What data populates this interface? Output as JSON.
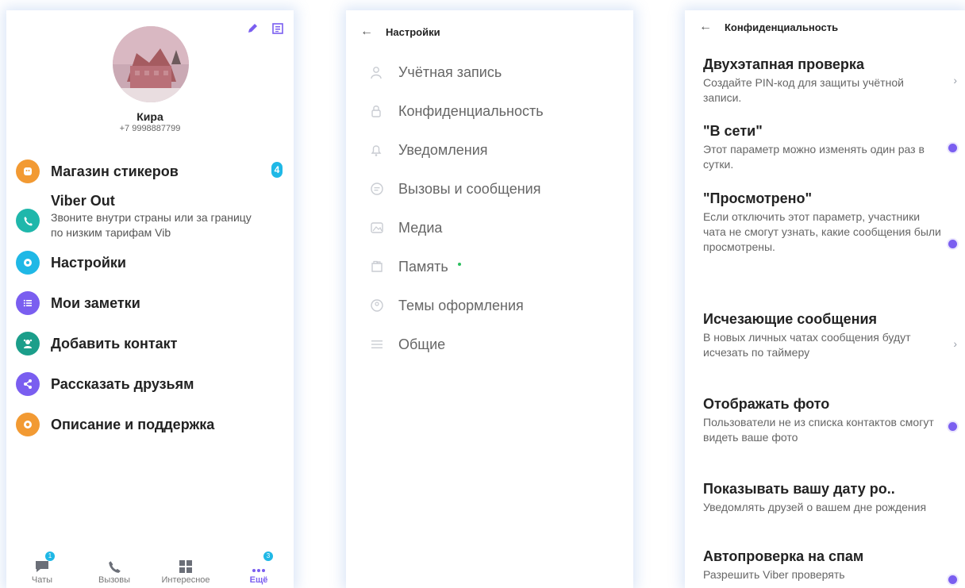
{
  "more_screen": {
    "profile": {
      "name": "Кира",
      "phone": "+7 9998887799"
    },
    "menu": [
      {
        "label": "Магазин стикеров",
        "badge": "4",
        "icon": "sticker-icon",
        "color": "#f29a33"
      },
      {
        "label": "Настройки",
        "icon": "gear-icon",
        "color": "#1fb8e6"
      },
      {
        "label": "Мои заметки",
        "icon": "notes-icon",
        "color": "#7a5ef0"
      },
      {
        "label": "Добавить контакт",
        "icon": "add-contact-icon",
        "color": "#1b9e8a"
      },
      {
        "label": "Рассказать друзьям",
        "icon": "share-icon",
        "color": "#7a5ef0"
      },
      {
        "label": "Описание и поддержка",
        "icon": "info-icon",
        "color": "#f29a33"
      }
    ],
    "viber_out": {
      "label": "Viber Out",
      "description": "Звоните внутри страны или за границу по низким тарифам Vib",
      "color": "#1fb7ab"
    },
    "bottom_nav": [
      {
        "label": "Чаты",
        "badge": "1"
      },
      {
        "label": "Вызовы"
      },
      {
        "label": "Интересное"
      },
      {
        "label": "Ещё",
        "badge": "3",
        "active": true
      }
    ],
    "accent_color": "#7a5ef0"
  },
  "settings_screen": {
    "back_icon": "arrow-left-icon",
    "title": "Настройки",
    "items": [
      {
        "label": "Учётная запись",
        "icon": "user-icon"
      },
      {
        "label": "Конфиденциальность",
        "icon": "lock-icon"
      },
      {
        "label": "Уведомления",
        "icon": "bell-icon"
      },
      {
        "label": "Вызовы и сообщения",
        "icon": "chat-icon"
      },
      {
        "label": "Медиа",
        "icon": "media-icon"
      },
      {
        "label": "Память",
        "icon": "storage-icon",
        "dot": true
      },
      {
        "label": "Темы оформления",
        "icon": "palette-icon"
      },
      {
        "label": "Общие",
        "icon": "menu-icon"
      }
    ]
  },
  "privacy_screen": {
    "title": "Конфиденциальность",
    "items": [
      {
        "title": "Двухэтапная проверка",
        "description": "Создайте PIN-код для защиты учётной записи.",
        "control": "chevron"
      },
      {
        "title": "\"В сети\"",
        "description": "Этот параметр можно изменять один раз в сутки.",
        "control": "toggle-on"
      },
      {
        "title": "\"Просмотрено\"",
        "description": "Если отключить этот параметр, участники чата не смогут узнать, какие сообщения были просмотрены.",
        "control": "toggle-on"
      },
      {
        "title": "Исчезающие сообщения",
        "description": "В новых личных чатах сообщения будут исчезать по таймеру",
        "control": "chevron"
      },
      {
        "title": "Отображать фото",
        "description": "Пользователи не из списка контактов смогут видеть ваше фото",
        "control": "toggle-on"
      },
      {
        "title": "Показывать вашу дату ро..",
        "description": "Уведомлять друзей о вашем дне рождения",
        "control": "none"
      },
      {
        "title": "Автопроверка на спам",
        "description": "Разрешить Viber проверять",
        "control": "toggle-on"
      }
    ]
  }
}
